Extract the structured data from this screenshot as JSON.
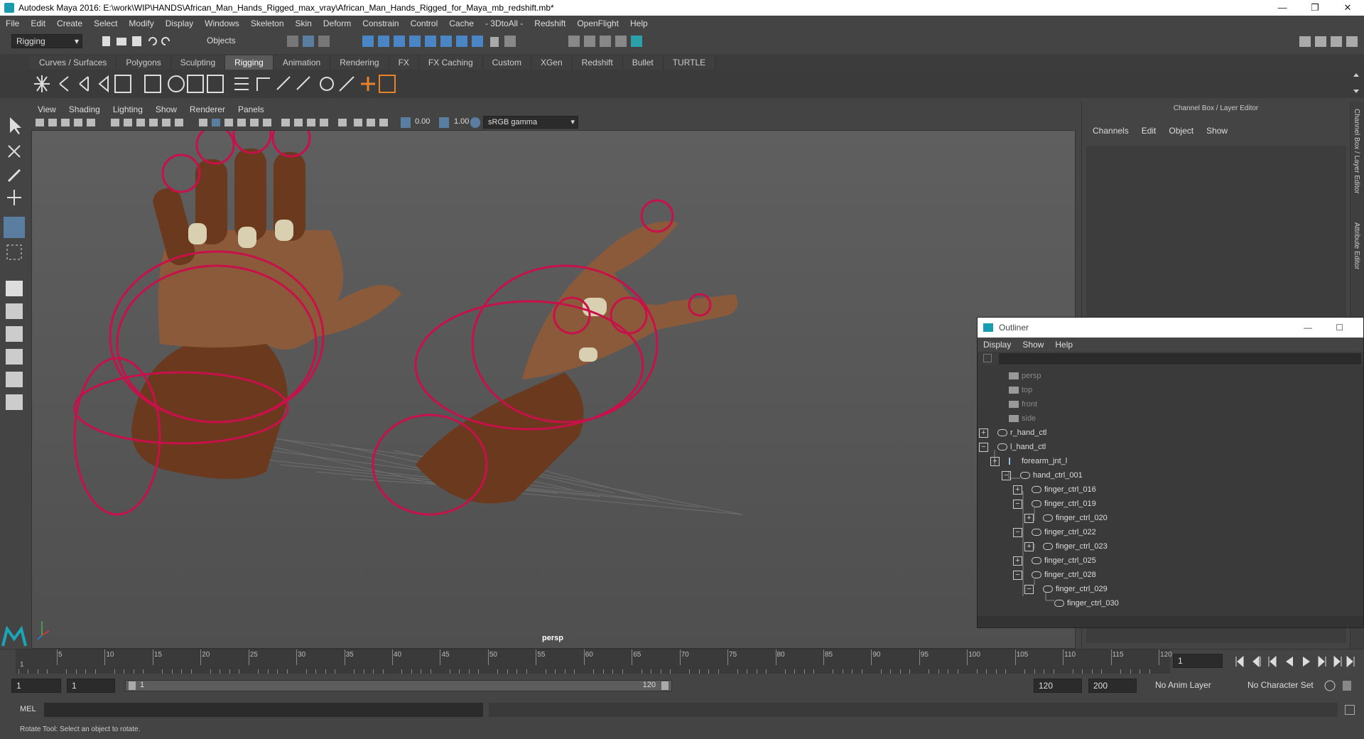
{
  "window": {
    "title": "Autodesk Maya 2016: E:\\work\\WIP\\HANDS\\African_Man_Hands_Rigged_max_vray\\African_Man_Hands_Rigged_for_Maya_mb_redshift.mb*",
    "minimize": "—",
    "restore": "❐",
    "close": "✕"
  },
  "menubar": [
    "File",
    "Edit",
    "Create",
    "Select",
    "Modify",
    "Display",
    "Windows",
    "Skeleton",
    "Skin",
    "Deform",
    "Constrain",
    "Control",
    "Cache",
    "- 3DtoAll -",
    "Redshift",
    "OpenFlight",
    "Help"
  ],
  "statusline": {
    "mode": "Rigging",
    "selection_mode": "Objects"
  },
  "shelf_tabs": [
    "Curves / Surfaces",
    "Polygons",
    "Sculpting",
    "Rigging",
    "Animation",
    "Rendering",
    "FX",
    "FX Caching",
    "Custom",
    "XGen",
    "Redshift",
    "Bullet",
    "TURTLE"
  ],
  "shelf_active": "Rigging",
  "viewport": {
    "menu": [
      "View",
      "Shading",
      "Lighting",
      "Show",
      "Renderer",
      "Panels"
    ],
    "exposure": "0.00",
    "gamma": "1.00",
    "color_space": "sRGB gamma",
    "camera_label": "persp"
  },
  "channelbox": {
    "header": "Channel Box / Layer Editor",
    "menu": [
      "Channels",
      "Edit",
      "Object",
      "Show"
    ],
    "side_tab_1": "Channel Box / Layer Editor",
    "side_tab_2": "Attribute Editor"
  },
  "outliner": {
    "title": "Outliner",
    "menu": [
      "Display",
      "Show",
      "Help"
    ],
    "rows": [
      {
        "label": "persp",
        "dim": true
      },
      {
        "label": "top",
        "dim": true
      },
      {
        "label": "front",
        "dim": true
      },
      {
        "label": "side",
        "dim": true
      },
      {
        "label": "r_hand_ctl",
        "dim": false
      },
      {
        "label": "l_hand_ctl",
        "dim": false
      },
      {
        "label": "forearm_jnt_l",
        "dim": false
      },
      {
        "label": "hand_ctrl_001",
        "dim": false
      },
      {
        "label": "finger_ctrl_016",
        "dim": false
      },
      {
        "label": "finger_ctrl_019",
        "dim": false
      },
      {
        "label": "finger_ctrl_020",
        "dim": false
      },
      {
        "label": "finger_ctrl_022",
        "dim": false
      },
      {
        "label": "finger_ctrl_023",
        "dim": false
      },
      {
        "label": "finger_ctrl_025",
        "dim": false
      },
      {
        "label": "finger_ctrl_028",
        "dim": false
      },
      {
        "label": "finger_ctrl_029",
        "dim": false
      },
      {
        "label": "finger_ctrl_030",
        "dim": false
      }
    ]
  },
  "timeline": {
    "ticks": [
      "5",
      "10",
      "15",
      "20",
      "25",
      "30",
      "35",
      "40",
      "45",
      "50",
      "55",
      "60",
      "65",
      "70",
      "75",
      "80",
      "85",
      "90",
      "95",
      "100",
      "105",
      "110",
      "115",
      "120"
    ],
    "start_marker": "1",
    "current_frame": "1"
  },
  "range": {
    "start": "1",
    "anim_start": "1",
    "slider_start": "1",
    "slider_end": "120",
    "anim_end": "120",
    "end": "200",
    "anim_layer": "No Anim Layer",
    "character_set": "No Character Set"
  },
  "cmdline": {
    "lang": "MEL"
  },
  "helpline": {
    "text": "Rotate Tool: Select an object to rotate."
  },
  "colors": {
    "control_curves": "#c8104a",
    "skin": "#6b3a1e",
    "accent": "#5b9bd5"
  }
}
